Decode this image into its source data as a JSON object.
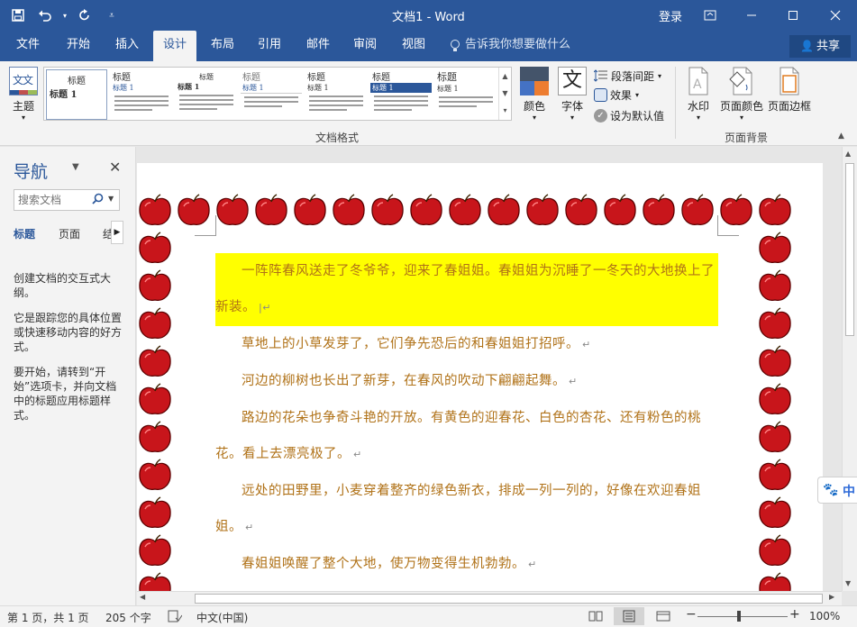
{
  "titlebar": {
    "title": "文档1 - Word",
    "login": "登录"
  },
  "tabs": [
    {
      "label": "文件"
    },
    {
      "label": "开始"
    },
    {
      "label": "插入"
    },
    {
      "label": "设计"
    },
    {
      "label": "布局"
    },
    {
      "label": "引用"
    },
    {
      "label": "邮件"
    },
    {
      "label": "审阅"
    },
    {
      "label": "视图"
    }
  ],
  "tell_me": "告诉我你想要做什么",
  "share": "共享",
  "ribbon": {
    "theme_label": "主题",
    "theme_icon_text": "文文",
    "gallery": [
      {
        "heading": "标题",
        "subheading": "标题 1"
      },
      {
        "heading": "标题",
        "subheading": "标题 1"
      },
      {
        "heading": "标题",
        "subheading": "标题 1"
      },
      {
        "heading": "标题",
        "subheading": "标题 1"
      },
      {
        "heading": "标题",
        "subheading": "标题 1"
      },
      {
        "heading": "标题",
        "subheading": "标题 1"
      },
      {
        "heading": "标题",
        "subheading": "标题 1"
      }
    ],
    "colors_label": "颜色",
    "fonts_label": "字体",
    "fonts_icon_text": "文",
    "paragraph_spacing": "段落间距",
    "effects": "效果",
    "set_default": "设为默认值",
    "group_doc_format": "文档格式",
    "watermark": "水印",
    "page_color": "页面颜色",
    "page_border": "页面边框",
    "group_page_bg": "页面背景"
  },
  "nav": {
    "title": "导航",
    "search_placeholder": "搜索文档",
    "tabs": [
      "标题",
      "页面",
      "结"
    ],
    "help": [
      "创建文档的交互式大纲。",
      "它是跟踪您的具体位置或快速移动内容的好方式。",
      "要开始，请转到“开始”选项卡，并向文档中的标题应用标题样式。"
    ]
  },
  "document": {
    "paragraphs": [
      "一阵阵春风送走了冬爷爷，迎来了春姐姐。春姐姐为沉睡了一冬天的大地换上了新装。",
      "草地上的小草发芽了，它们争先恐后的和春姐姐打招呼。",
      "河边的柳树也长出了新芽，在春风的吹动下翩翩起舞。",
      "路边的花朵也争奇斗艳的开放。有黄色的迎春花、白色的杏花、还有粉色的桃花。看上去漂亮极了。",
      "远处的田野里，小麦穿着整齐的绿色新衣，排成一列一列的，好像在欢迎春姐姐。",
      "春姐姐唤醒了整个大地，使万物变得生机勃勃。"
    ]
  },
  "sidechip": {
    "text": "中"
  },
  "status": {
    "page": "第 1 页，共 1 页",
    "words": "205 个字",
    "language": "中文(中国)",
    "zoom": "100%"
  },
  "colors": {
    "brand": "#2b579a",
    "text": "#b07218",
    "highlight": "#ffff00",
    "apple": "#c8151b"
  }
}
